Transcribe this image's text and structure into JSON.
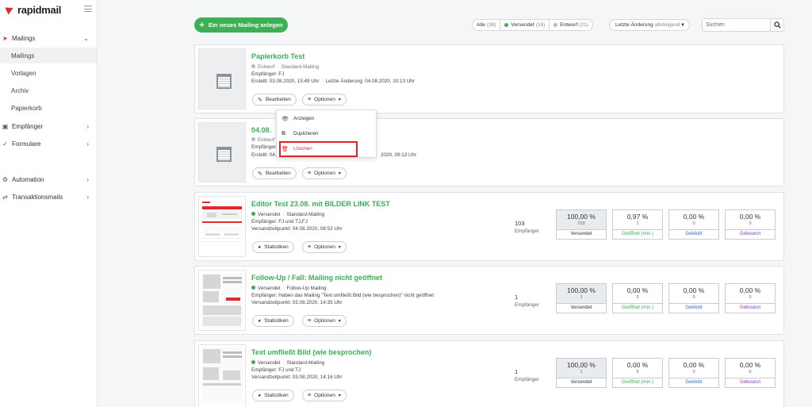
{
  "app": {
    "name": "rapidmail"
  },
  "sidebar": {
    "items": [
      {
        "label": "Mailings",
        "level": 0,
        "has_chevron": true,
        "chevron": "⌄",
        "icon": "send-icon"
      },
      {
        "label": "Mailings",
        "level": 1,
        "active": true
      },
      {
        "label": "Vorlagen",
        "level": 1
      },
      {
        "label": "Archiv",
        "level": 1
      },
      {
        "label": "Papierkorb",
        "level": 1
      },
      {
        "label": "Empfänger",
        "level": 0,
        "has_chevron": true,
        "chevron": "›",
        "icon": "users-icon"
      },
      {
        "label": "Formulare",
        "level": 0,
        "has_chevron": true,
        "chevron": "›",
        "icon": "check-icon"
      },
      {
        "label": "Automation",
        "level": 0,
        "has_chevron": true,
        "chevron": "›",
        "icon": "automation-icon"
      },
      {
        "label": "Transaktionsmails",
        "level": 0,
        "has_chevron": true,
        "chevron": "›",
        "icon": "exchange-icon"
      }
    ]
  },
  "toolbar": {
    "new_mailing_label": "Ein neues Mailing anlegen",
    "filters": [
      {
        "label": "Alle",
        "count": "(38)"
      },
      {
        "label": "Versendet",
        "count": "(18)",
        "dot": "green"
      },
      {
        "label": "Entwurf",
        "count": "(21)",
        "dot": "gray"
      }
    ],
    "sort_label": "Letzte Änderung",
    "sort_sub": "absteigend",
    "search_placeholder": "Suchen"
  },
  "labels": {
    "edit": "Bearbeiten",
    "options": "Optionen",
    "statistics": "Statistiken",
    "recipients": "Empfänger"
  },
  "mailings": [
    {
      "title": "Papierkorb Test",
      "status": "Entwurf",
      "type": "Standard-Mailing",
      "recipients_line": "Empfänger: FJ",
      "created": "Erstellt: 03.08.2020, 15:49 Uhr",
      "changed": "Letzte Änderung: 04.08.2020, 10:13 Uhr"
    },
    {
      "title": "04.08.",
      "status": "Entwurf",
      "recipients_line": "Empfänger",
      "created": "Erstellt: 04.",
      "changed": "2020, 09:13 Uhr"
    },
    {
      "title": "Editor Test 23.08. mit BILDER LINK TEST",
      "status": "Versendet",
      "type": "Standard-Mailing",
      "recipients_line": "Empfänger: FJ und TJ,FJ",
      "sent_at": "Versandzeitpunkt: 04.08.2020, 08:52 Uhr",
      "recipient_count": "103",
      "stats": [
        {
          "value": "100,00 %",
          "count": "103",
          "label": "Versendet"
        },
        {
          "value": "0,97 %",
          "count": "1",
          "label": "Geöffnet (min.)"
        },
        {
          "value": "0,00 %",
          "count": "0",
          "label": "Geklickt"
        },
        {
          "value": "0,00 %",
          "count": "0",
          "label": "Gebounct"
        }
      ]
    },
    {
      "title": "Follow-Up / Fall: Mailing nicht geöffnet",
      "status": "Versendet",
      "type": "Follow-Up Mailing",
      "recipients_line": "Empfänger: Haben das Mailing \"Text umfließt Bild (wie besprochen)\" nicht geöffnet",
      "sent_at": "Versandzeitpunkt: 03.08.2020, 14:35 Uhr",
      "recipient_count": "1",
      "stats": [
        {
          "value": "100,00 %",
          "count": "1",
          "label": "Versendet"
        },
        {
          "value": "0,00 %",
          "count": "0",
          "label": "Geöffnet (min.)"
        },
        {
          "value": "0,00 %",
          "count": "0",
          "label": "Geklickt"
        },
        {
          "value": "0,00 %",
          "count": "0",
          "label": "Gebounct"
        }
      ]
    },
    {
      "title": "Text umfließt Bild (wie besprochen)",
      "status": "Versendet",
      "type": "Standard-Mailing",
      "recipients_line": "Empfänger: FJ und TJ",
      "sent_at": "Versandzeitpunkt: 03.08.2020, 14:16 Uhr",
      "recipient_count": "1",
      "stats": [
        {
          "value": "100,00 %",
          "count": "1",
          "label": "Versendet"
        },
        {
          "value": "0,00 %",
          "count": "0",
          "label": "Geöffnet (min.)"
        },
        {
          "value": "0,00 %",
          "count": "0",
          "label": "Geklickt"
        },
        {
          "value": "0,00 %",
          "count": "0",
          "label": "Gebounct"
        }
      ]
    }
  ],
  "options_menu": {
    "items": [
      {
        "label": "Anzeigen",
        "icon": "eye-icon"
      },
      {
        "label": "Duplizieren",
        "icon": "duplicate-icon"
      },
      {
        "label": "Löschen",
        "icon": "trash-icon"
      }
    ]
  },
  "colors": {
    "brand_green": "#3bb054",
    "brand_red": "#e02b2b",
    "opened_label": "#3bb054",
    "clicked_label": "#2b6cc4",
    "bounced_label": "#8a3cb4"
  }
}
